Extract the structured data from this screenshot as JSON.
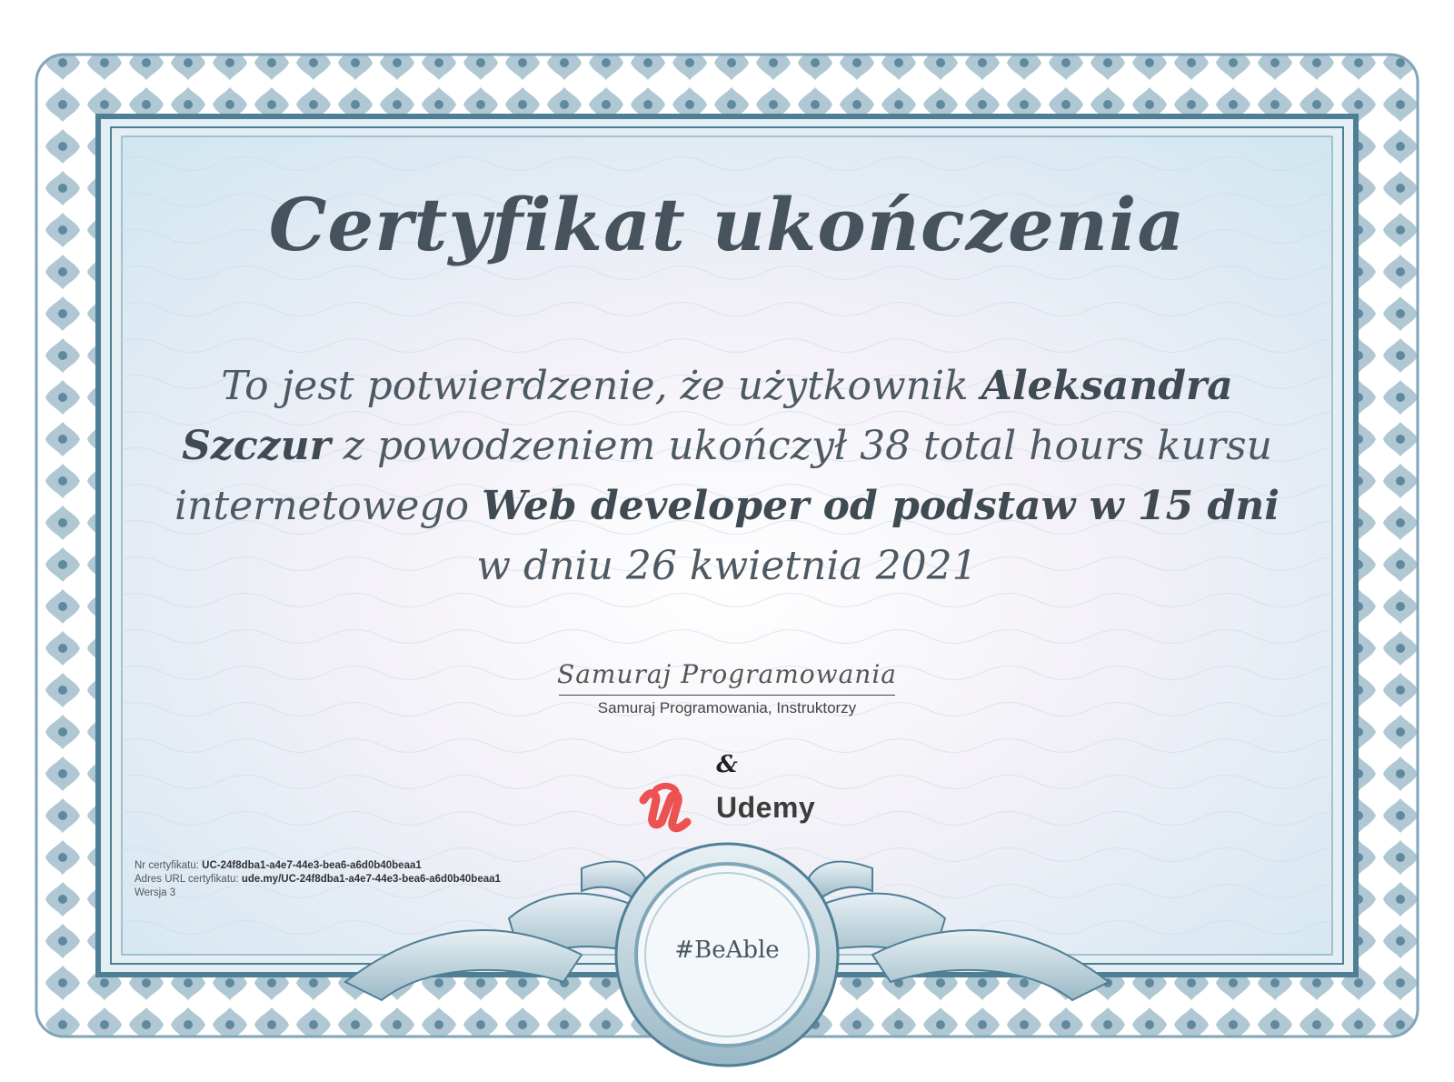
{
  "certificate": {
    "title": "Certyfikat ukończenia",
    "statement": {
      "prefix": "To jest potwierdzenie, że użytkownik ",
      "student_name": "Aleksandra Szczur",
      "middle1": " z powodzeniem ukończył 38 total hours kursu internetowego ",
      "course_name": "Web developer od podstaw w 15 dni",
      "suffix": " w dniu 26 kwietnia 2021"
    },
    "signature_script": "Samuraj Programowania",
    "signature_caption": "Samuraj Programowania, Instruktorzy",
    "ampersand": "&",
    "brand": {
      "logo_letter": "u",
      "name": "Udemy",
      "logo_color": "#ec5252"
    },
    "info": {
      "number_label": "Nr certyfikatu: ",
      "number_value": "UC-24f8dba1-a4e7-44e3-bea6-a6d0b40beaa1",
      "url_label": "Adres URL certyfikatu: ",
      "url_value": "ude.my/UC-24f8dba1-a4e7-44e3-bea6-a6d0b40beaa1",
      "version": "Wersja 3"
    },
    "badge": "#BeAble"
  },
  "colors": {
    "border": "#4f7f95",
    "border_light": "#8fb3c4",
    "panel_top": "#d6ecf4",
    "panel_mid": "#f3f1f7",
    "text": "#46535d"
  }
}
